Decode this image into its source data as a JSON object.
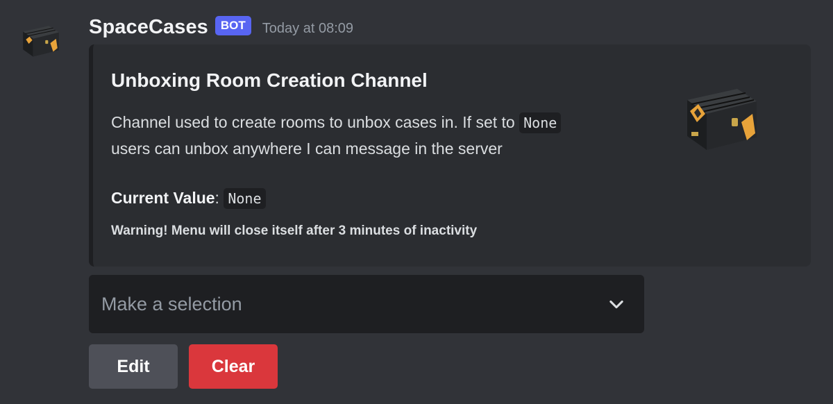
{
  "message": {
    "author": "SpaceCases",
    "tag": "BOT",
    "timestamp": "Today at 08:09",
    "avatar_icon": "weapon-case-icon"
  },
  "embed": {
    "title": "Unboxing Room Creation Channel",
    "description_before": "Channel used to create rooms to unbox cases in. If set to ",
    "description_code": "None",
    "description_after": " users can unbox anywhere I can message in the server",
    "field_name": "Current Value",
    "field_separator": ": ",
    "field_value": "None",
    "footer": "Warning! Menu will close itself after 3 minutes of inactivity",
    "thumbnail_icon": "weapon-case-icon"
  },
  "select": {
    "placeholder": "Make a selection",
    "icon": "chevron-down-icon"
  },
  "buttons": {
    "edit": "Edit",
    "clear": "Clear"
  },
  "colors": {
    "background": "#313338",
    "embed_background": "#2b2d31",
    "bot_tag": "#5865f2",
    "secondary_button": "#4e5058",
    "danger_button": "#da373c",
    "case_accent": "#e8a33a"
  }
}
